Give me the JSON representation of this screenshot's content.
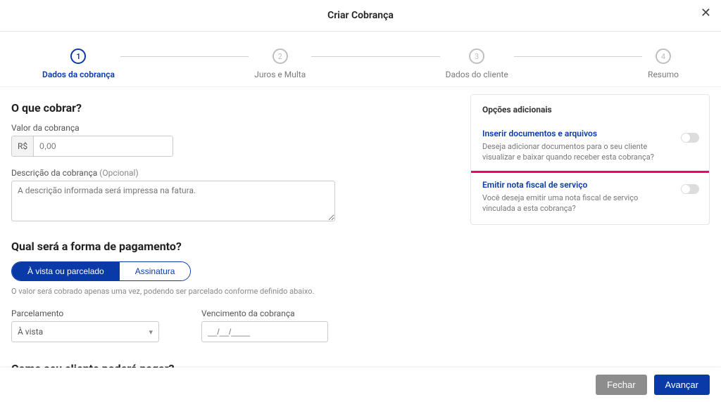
{
  "header": {
    "title": "Criar Cobrança"
  },
  "steps": [
    {
      "num": "1",
      "label": "Dados da cobrança"
    },
    {
      "num": "2",
      "label": "Juros e Multa"
    },
    {
      "num": "3",
      "label": "Dados do cliente"
    },
    {
      "num": "4",
      "label": "Resumo"
    }
  ],
  "section_whatcharge": "O que cobrar?",
  "field_value": {
    "label": "Valor da cobrança",
    "prefix": "R$",
    "placeholder": "0,00"
  },
  "field_desc": {
    "label": "Descrição da cobrança",
    "optional": "(Opcional)",
    "placeholder": "A descrição informada será impressa na fatura."
  },
  "section_payment": "Qual será a forma de pagamento?",
  "segment": {
    "a": "À vista ou parcelado",
    "b": "Assinatura"
  },
  "payment_help": "O valor será cobrado apenas uma vez, podendo ser parcelado conforme definido abaixo.",
  "field_parcel": {
    "label": "Parcelamento",
    "value": "À vista"
  },
  "field_due": {
    "label": "Vencimento da cobrança",
    "placeholder": "__/__/____"
  },
  "section_howpay": "Como seu cliente poderá pagar?",
  "options": {
    "title": "Opções adicionais",
    "docs": {
      "title": "Inserir documentos e arquivos",
      "desc": "Deseja adicionar documentos para o seu cliente visualizar e baixar quando receber esta cobrança?"
    },
    "nf": {
      "title": "Emitir nota fiscal de serviço",
      "desc": "Você deseja emitir uma nota fiscal de serviço vinculada a esta cobrança?"
    }
  },
  "footer": {
    "close": "Fechar",
    "next": "Avançar"
  }
}
